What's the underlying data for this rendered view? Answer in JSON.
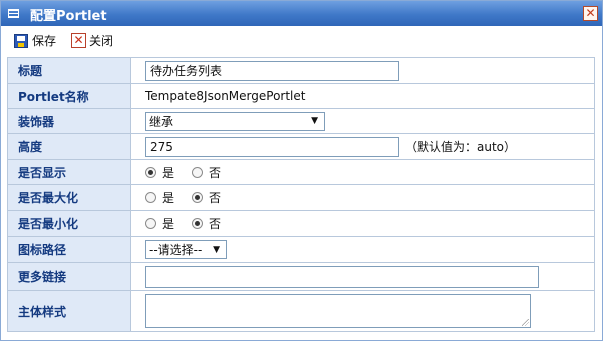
{
  "window": {
    "title": "配置Portlet",
    "close_glyph": "✕"
  },
  "toolbar": {
    "save_label": "保存",
    "close_label": "关闭"
  },
  "form": {
    "title": {
      "label": "标题",
      "value": "待办任务列表"
    },
    "portlet_name": {
      "label": "Portlet名称",
      "value": "Tempate8JsonMergePortlet"
    },
    "decorator": {
      "label": "装饰器",
      "selected": "继承"
    },
    "height": {
      "label": "高度",
      "value": "275",
      "hint": "（默认值为：auto）"
    },
    "show": {
      "label": "是否显示",
      "yes": "是",
      "no": "否",
      "selected": "yes"
    },
    "maximize": {
      "label": "是否最大化",
      "yes": "是",
      "no": "否",
      "selected": "no"
    },
    "minimize": {
      "label": "是否最小化",
      "yes": "是",
      "no": "否",
      "selected": "no"
    },
    "icon_path": {
      "label": "图标路径",
      "selected": "--请选择--"
    },
    "more_link": {
      "label": "更多链接",
      "value": ""
    },
    "body_style": {
      "label": "主体样式",
      "value": ""
    }
  },
  "icons": {
    "window": "window-icon",
    "save": "floppy-disk-icon",
    "close": "close-x-icon",
    "dropdown": "dropdown-arrow-icon"
  },
  "colors": {
    "titlebar": "#3f78c8",
    "label_bg": "#dfe9f7",
    "label_text": "#143a80",
    "border": "#b8c8dc"
  }
}
